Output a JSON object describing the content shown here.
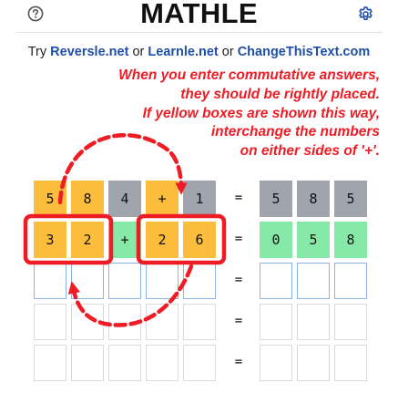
{
  "header": {
    "title": "MATHLE",
    "help_icon": "help-circle-icon",
    "settings_icon": "gear-icon"
  },
  "promo": {
    "prefix": "Try ",
    "link1": "Reversle.net",
    "or1": " or ",
    "link2": "Learnle.net",
    "or2": " or ",
    "link3": "ChangeThisText.com"
  },
  "annotation": {
    "color": "#ee1c25",
    "lines": [
      "When you enter commutative answers,",
      "they should be rightly placed.",
      "If yellow boxes are shown this way,",
      "interchange the numbers",
      "on either sides of '+'."
    ]
  },
  "colors": {
    "yellow": "#fbbd3b",
    "gray": "#9fa4ad",
    "green": "#87e9a8",
    "empty_blue_border": "#8bb3e6"
  },
  "board": {
    "equals_sign": "=",
    "rows": [
      {
        "guess": [
          {
            "ch": "5",
            "state": "yellow"
          },
          {
            "ch": "8",
            "state": "yellow"
          },
          {
            "ch": "4",
            "state": "gray"
          },
          {
            "ch": "+",
            "state": "yellow"
          },
          {
            "ch": "1",
            "state": "gray"
          }
        ],
        "result": [
          {
            "ch": "5",
            "state": "gray"
          },
          {
            "ch": "8",
            "state": "gray"
          },
          {
            "ch": "5",
            "state": "gray"
          }
        ]
      },
      {
        "guess": [
          {
            "ch": "3",
            "state": "yellow"
          },
          {
            "ch": "2",
            "state": "yellow"
          },
          {
            "ch": "+",
            "state": "green"
          },
          {
            "ch": "2",
            "state": "yellow"
          },
          {
            "ch": "6",
            "state": "yellow"
          }
        ],
        "result": [
          {
            "ch": "0",
            "state": "green"
          },
          {
            "ch": "5",
            "state": "green"
          },
          {
            "ch": "8",
            "state": "green"
          }
        ]
      },
      {
        "guess": [
          {
            "ch": "",
            "state": "empty-blue"
          },
          {
            "ch": "",
            "state": "empty-blue"
          },
          {
            "ch": "",
            "state": "empty-blue"
          },
          {
            "ch": "",
            "state": "empty-blue"
          },
          {
            "ch": "",
            "state": "empty-blue"
          }
        ],
        "result": [
          {
            "ch": "",
            "state": "empty-blue"
          },
          {
            "ch": "",
            "state": "empty-blue"
          },
          {
            "ch": "",
            "state": "empty-blue"
          }
        ]
      },
      {
        "guess": [
          {
            "ch": "",
            "state": "empty-gray"
          },
          {
            "ch": "",
            "state": "empty-gray"
          },
          {
            "ch": "",
            "state": "empty-gray"
          },
          {
            "ch": "",
            "state": "empty-gray"
          },
          {
            "ch": "",
            "state": "empty-gray"
          }
        ],
        "result": [
          {
            "ch": "",
            "state": "empty-gray"
          },
          {
            "ch": "",
            "state": "empty-gray"
          },
          {
            "ch": "",
            "state": "empty-gray"
          }
        ]
      },
      {
        "guess": [
          {
            "ch": "",
            "state": "empty-gray"
          },
          {
            "ch": "",
            "state": "empty-gray"
          },
          {
            "ch": "",
            "state": "empty-gray"
          },
          {
            "ch": "",
            "state": "empty-gray"
          },
          {
            "ch": "",
            "state": "empty-gray"
          }
        ],
        "result": [
          {
            "ch": "",
            "state": "empty-gray"
          },
          {
            "ch": "",
            "state": "empty-gray"
          },
          {
            "ch": "",
            "state": "empty-gray"
          }
        ]
      }
    ]
  }
}
